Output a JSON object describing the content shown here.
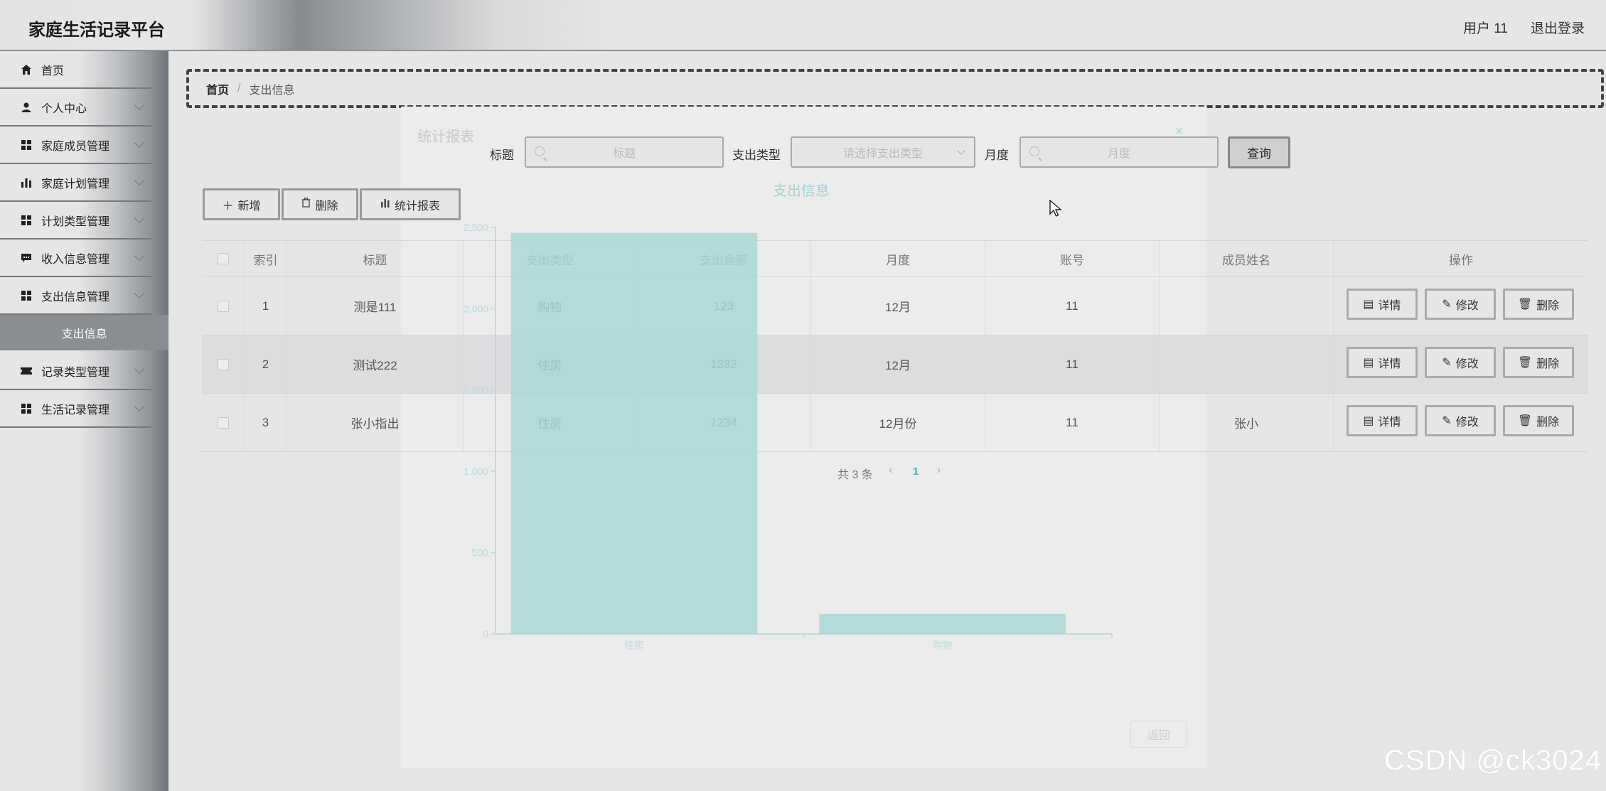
{
  "header": {
    "brand": "家庭生活记录平台",
    "user": "用户 11",
    "logout": "退出登录"
  },
  "sidebar": {
    "items": [
      {
        "label": "首页"
      },
      {
        "label": "个人中心"
      },
      {
        "label": "家庭成员管理"
      },
      {
        "label": "家庭计划管理"
      },
      {
        "label": "计划类型管理"
      },
      {
        "label": "收入信息管理"
      },
      {
        "label": "支出信息管理"
      },
      {
        "label": "记录类型管理"
      },
      {
        "label": "生活记录管理"
      }
    ],
    "active_sub": "支出信息"
  },
  "breadcrumb": {
    "home": "首页",
    "sep": "/",
    "current": "支出信息"
  },
  "search": {
    "title_label": "标题",
    "title_placeholder": "标题",
    "type_label": "支出类型",
    "type_placeholder": "请选择支出类型",
    "month_label": "月度",
    "month_placeholder": "月度",
    "query": "查询"
  },
  "toolbar": {
    "add": "新增",
    "delete": "删除",
    "report": "统计报表"
  },
  "table": {
    "headers": [
      "索引",
      "标题",
      "支出类型",
      "支出金额",
      "月度",
      "账号",
      "成员姓名",
      "操作"
    ],
    "rows": [
      {
        "index": "1",
        "title": "测是111",
        "type": "购物",
        "amount": "123",
        "month": "12月",
        "account": "11",
        "member": ""
      },
      {
        "index": "2",
        "title": "测试222",
        "type": "住房",
        "amount": "1232",
        "month": "12月",
        "account": "11",
        "member": ""
      },
      {
        "index": "3",
        "title": "张小指出",
        "type": "住房",
        "amount": "1234",
        "month": "12月份",
        "account": "11",
        "member": "张小"
      }
    ],
    "row_actions": {
      "detail": "详情",
      "edit": "修改",
      "delete": "删除"
    }
  },
  "pagination": {
    "total": "共 3 条",
    "current": "1"
  },
  "modal": {
    "title": "统计报表",
    "close": "×",
    "back": "返回"
  },
  "chart_data": {
    "type": "bar",
    "title": "支出信息",
    "categories": [
      "住房",
      "购物"
    ],
    "values": [
      2466,
      123
    ],
    "ylim": [
      0,
      2500
    ],
    "yticks": [
      "0",
      "500",
      "1,000",
      "1,500",
      "2,000",
      "2,500"
    ],
    "grid": false,
    "color": "#a9d8d6"
  },
  "watermark": "CSDN @ck3024"
}
